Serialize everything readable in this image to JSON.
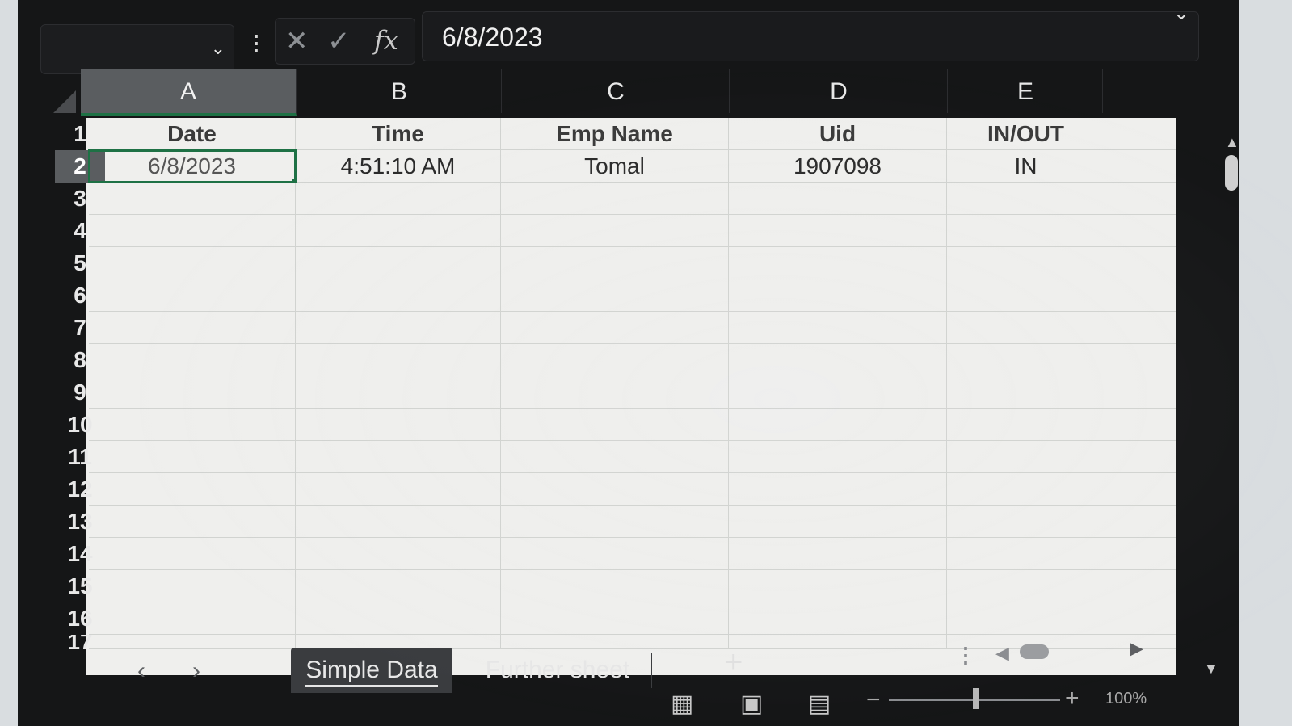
{
  "formula_bar": {
    "name_box_value": "",
    "cancel_icon": "close-icon",
    "enter_icon": "check-icon",
    "fx_label": "fx",
    "formula_value": "6/8/2023"
  },
  "columns": [
    "A",
    "B",
    "C",
    "D",
    "E"
  ],
  "rows": [
    "1",
    "2",
    "3",
    "4",
    "5",
    "6",
    "7",
    "8",
    "9",
    "10",
    "11",
    "12",
    "13",
    "14",
    "15",
    "16",
    "17"
  ],
  "selected_cell": "A2",
  "data": {
    "headers": [
      "Date",
      "Time",
      "Emp Name",
      "Uid",
      "IN/OUT"
    ],
    "record": [
      "6/8/2023",
      "4:51:10 AM",
      "Tomal",
      "1907098",
      "IN"
    ]
  },
  "tabs": {
    "active": "Simple Data",
    "other": "Further sheet",
    "add_label": "+"
  },
  "status": {
    "zoom": "100%",
    "zoom_minus": "−",
    "zoom_plus": "+"
  },
  "colors": {
    "accent": "#1e7145",
    "frame": "#151617",
    "grid": "#efefed"
  }
}
